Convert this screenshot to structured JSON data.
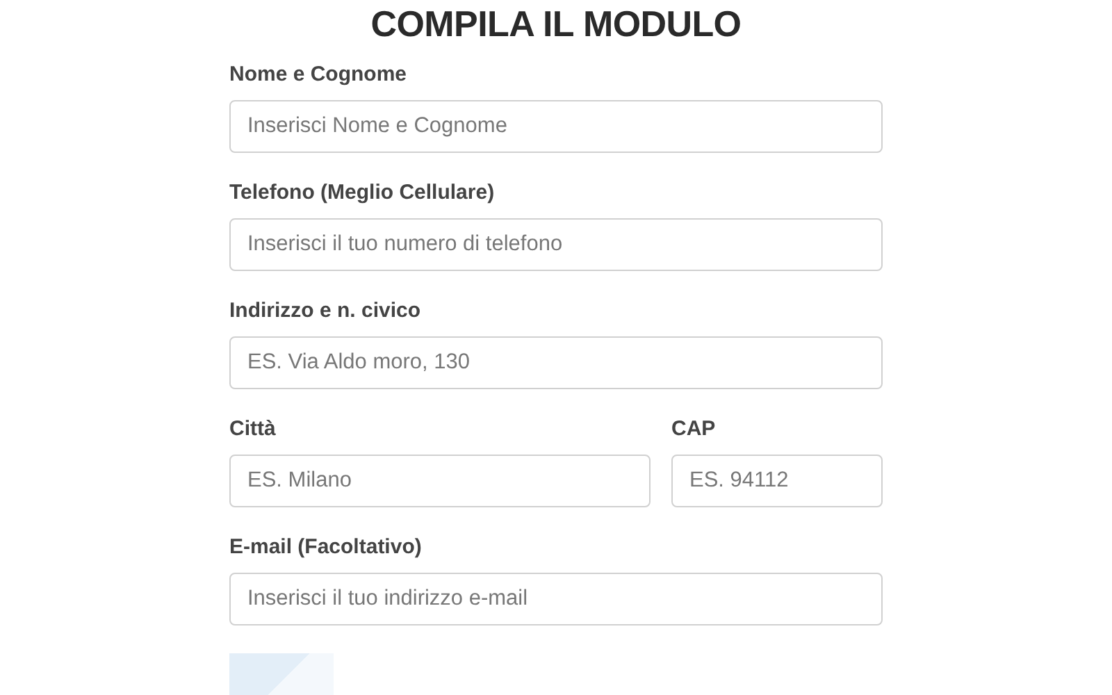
{
  "title": "COMPILA IL MODULO",
  "rows": [
    [
      {
        "label": "Nome e Cognome",
        "placeholder": "Inserisci Nome e Cognome"
      }
    ],
    [
      {
        "label": "Telefono (Meglio Cellulare)",
        "placeholder": "Inserisci il tuo numero di telefono"
      }
    ],
    [
      {
        "label": "Indirizzo e n. civico",
        "placeholder": "ES. Via Aldo moro, 130"
      }
    ],
    [
      {
        "label": "Città",
        "placeholder": "ES. Milano"
      },
      {
        "label": "CAP",
        "placeholder": "ES. 94112"
      }
    ],
    [
      {
        "label": "E-mail (Facoltativo)",
        "placeholder": "Inserisci il tuo indirizzo e-mail"
      }
    ]
  ]
}
